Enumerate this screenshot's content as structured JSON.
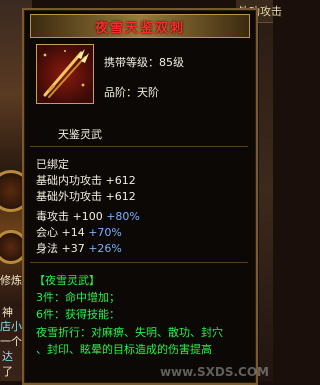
{
  "background": {
    "top_right_label": "外功攻击",
    "left_labels": [
      {
        "text": "修炼",
        "color": "#f0e6c8"
      },
      {
        "text": "神",
        "color": "#f0e6c8"
      },
      {
        "text": "店小",
        "color": "#7ee0e8"
      },
      {
        "text": "一个",
        "color": "#f0e6c8"
      },
      {
        "text": "达",
        "color": "#7ee0e8"
      },
      {
        "text": "了",
        "color": "#f0e6c8"
      }
    ]
  },
  "tooltip": {
    "title": "夜雪天鉴双刺",
    "icon": "dual-daggers-icon",
    "required_level": "携带等级：85级",
    "grade": "品阶：天阶",
    "category": "天鉴灵武",
    "bind_status": "已绑定",
    "stats": [
      {
        "name": "基础内功攻击",
        "value": "+612",
        "bonus": ""
      },
      {
        "name": "基础外功攻击",
        "value": "+612",
        "bonus": ""
      },
      {
        "name": "毒攻击",
        "value": "+100",
        "bonus": "+80%"
      },
      {
        "name": "会心",
        "value": "+14",
        "bonus": "+70%"
      },
      {
        "name": "身法",
        "value": "+37",
        "bonus": "+26%"
      }
    ],
    "set_name": "【夜雪灵武】",
    "set_bonuses": [
      "3件：命中增加；",
      "6件：获得技能："
    ],
    "skill_desc_line1": "夜雪折行：对麻痹、失明、散功、封穴",
    "skill_desc_line2": "、封印、眩晕的目标造成的伤害提高"
  },
  "watermark": "www.SXDS.COM"
}
